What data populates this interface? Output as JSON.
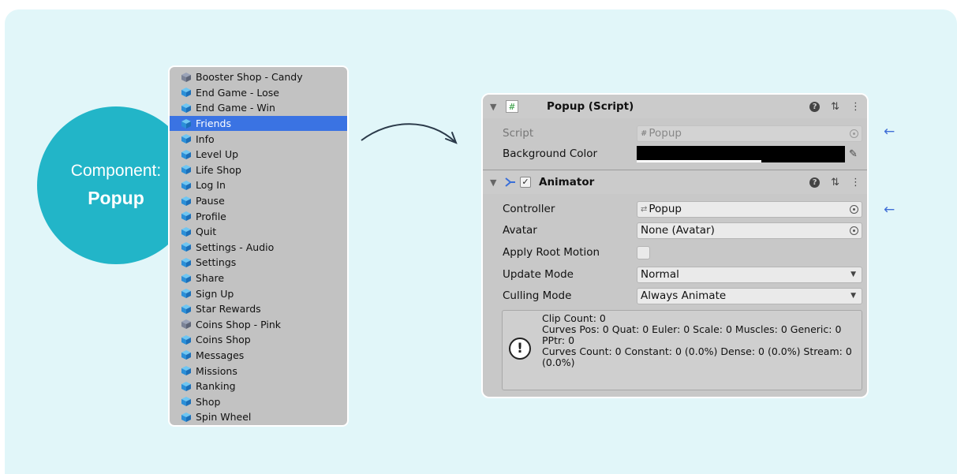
{
  "badge": {
    "line1": "Component:",
    "line2": "Popup"
  },
  "prefabs": [
    {
      "label": "Booster Shop - Candy",
      "icon": "prefab-variant-icon"
    },
    {
      "label": "End Game - Lose",
      "icon": "prefab-icon"
    },
    {
      "label": "End Game - Win",
      "icon": "prefab-icon"
    },
    {
      "label": "Friends",
      "icon": "prefab-icon",
      "selected": true
    },
    {
      "label": "Info",
      "icon": "prefab-icon"
    },
    {
      "label": "Level Up",
      "icon": "prefab-icon"
    },
    {
      "label": "Life Shop",
      "icon": "prefab-icon"
    },
    {
      "label": "Log In",
      "icon": "prefab-icon"
    },
    {
      "label": "Pause",
      "icon": "prefab-icon"
    },
    {
      "label": "Profile",
      "icon": "prefab-icon"
    },
    {
      "label": "Quit",
      "icon": "prefab-icon"
    },
    {
      "label": "Settings - Audio",
      "icon": "prefab-icon"
    },
    {
      "label": "Settings",
      "icon": "prefab-icon"
    },
    {
      "label": "Share",
      "icon": "prefab-icon"
    },
    {
      "label": "Sign Up",
      "icon": "prefab-icon"
    },
    {
      "label": "Star Rewards",
      "icon": "prefab-icon"
    },
    {
      "label": "Coins Shop - Pink",
      "icon": "prefab-variant-icon"
    },
    {
      "label": "Coins Shop",
      "icon": "prefab-icon"
    },
    {
      "label": "Messages",
      "icon": "prefab-icon"
    },
    {
      "label": "Missions",
      "icon": "prefab-icon"
    },
    {
      "label": "Ranking",
      "icon": "prefab-icon"
    },
    {
      "label": "Shop",
      "icon": "prefab-icon"
    },
    {
      "label": "Spin Wheel",
      "icon": "prefab-icon"
    }
  ],
  "inspector": {
    "script_component": {
      "title": "Popup (Script)",
      "script_label": "Script",
      "script_value": "Popup",
      "bg_color_label": "Background Color",
      "bg_color": "#000000"
    },
    "animator": {
      "title": "Animator",
      "enabled": true,
      "controller_label": "Controller",
      "controller_value": "Popup",
      "avatar_label": "Avatar",
      "avatar_value": "None (Avatar)",
      "root_motion_label": "Apply Root Motion",
      "update_mode_label": "Update Mode",
      "update_mode_value": "Normal",
      "culling_mode_label": "Culling Mode",
      "culling_mode_value": "Always Animate",
      "info_lines": [
        "Clip Count: 0",
        "Curves Pos: 0 Quat: 0 Euler: 0 Scale: 0 Muscles: 0 Generic: 0",
        "PPtr: 0",
        "Curves Count: 0 Constant: 0 (0.0%) Dense: 0 (0.0%) Stream: 0",
        "(0.0%)"
      ]
    }
  },
  "colors": {
    "background": "#e1f6f9",
    "badge": "#22b5c8",
    "selection": "#3a73e3",
    "side_arrow": "#3f6ed6"
  }
}
